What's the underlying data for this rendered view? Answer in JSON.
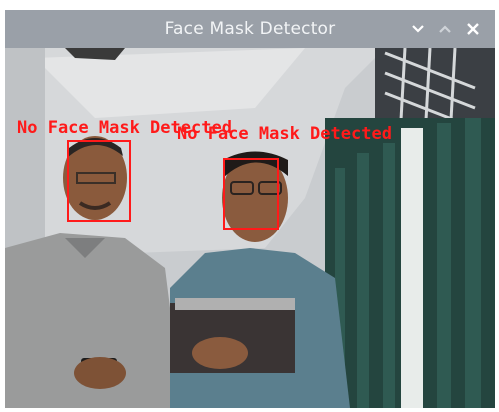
{
  "window": {
    "title": "Face Mask Detector",
    "controls": {
      "minimize_icon": "chevron-down-icon",
      "maximize_icon": "chevron-up-icon",
      "close_icon": "close-icon"
    }
  },
  "detections": [
    {
      "label": "No Face Mask Detected"
    },
    {
      "label": "No Face Mask Detected"
    }
  ],
  "colors": {
    "detection": "#ff1a1a",
    "titlebar": "#9aa0a8"
  }
}
